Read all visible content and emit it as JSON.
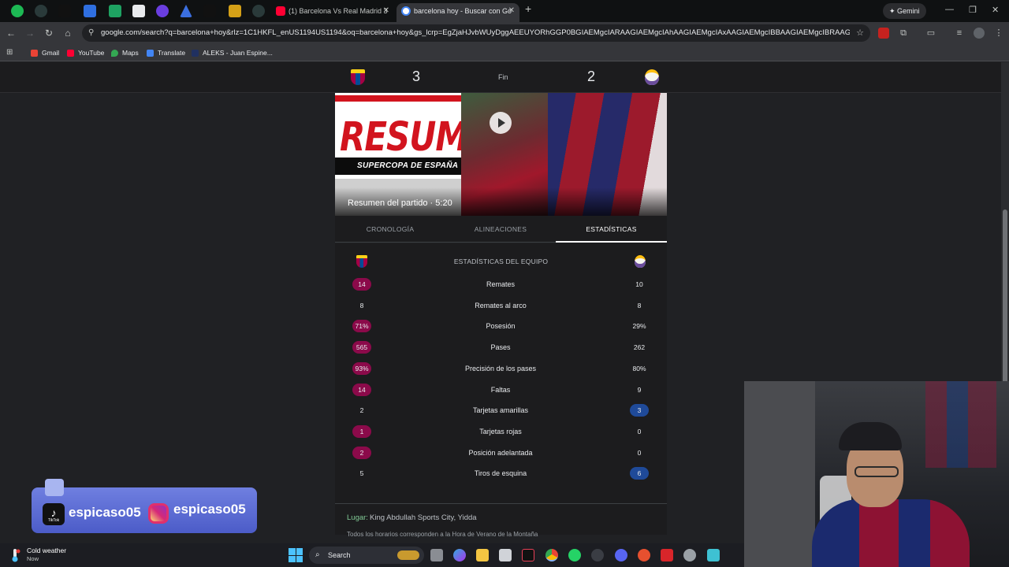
{
  "browser": {
    "tabs": [
      {
        "title": "(1) Barcelona Vs Real Madrid 3",
        "active": false
      },
      {
        "title": "barcelona hoy - Buscar con Go",
        "active": true
      }
    ],
    "gemini_label": "Gemini",
    "url": "google.com/search?q=barcelona+hoy&rlz=1C1HKFL_enUS1194US1194&oq=barcelona+hoy&gs_lcrp=EgZjaHJvbWUyDggAEEUYORhGGP0BGIAEMgcIARAAGIAEMgcIAhAAGIAEMgcIAxAAGIAEMgcIBBAAGIAEMgcIBRAAGIAEMgcIB...",
    "bookmarks": [
      "Gmail",
      "YouTube",
      "Maps",
      "Translate",
      "ALEKS - Juan Espine..."
    ]
  },
  "match": {
    "home_score": "3",
    "away_score": "2",
    "status": "Fin"
  },
  "video": {
    "overlay_title": "RESUMEN",
    "overlay_subtitle": "SUPERCOPA DE ESPAÑA",
    "caption": "Resumen del partido · 5:20"
  },
  "stats_tabs": [
    "CRONOLOGÍA",
    "ALINEACIONES",
    "ESTADÍSTICAS"
  ],
  "stats": {
    "title": "ESTADÍSTICAS DEL EQUIPO",
    "rows": [
      {
        "name": "Remates",
        "home": "14",
        "away": "10"
      },
      {
        "name": "Remates al arco",
        "home": "8",
        "away": "8"
      },
      {
        "name": "Posesión",
        "home": "71%",
        "away": "29%"
      },
      {
        "name": "Pases",
        "home": "565",
        "away": "262"
      },
      {
        "name": "Precisión de los pases",
        "home": "93%",
        "away": "80%"
      },
      {
        "name": "Faltas",
        "home": "14",
        "away": "9"
      },
      {
        "name": "Tarjetas amarillas",
        "home": "2",
        "away": "3"
      },
      {
        "name": "Tarjetas rojas",
        "home": "1",
        "away": "0"
      },
      {
        "name": "Posición adelantada",
        "home": "2",
        "away": "0"
      },
      {
        "name": "Tiros de esquina",
        "home": "5",
        "away": "6"
      }
    ]
  },
  "venue": {
    "label": "Lugar:",
    "value": "King Abdullah Sports City, Yidda"
  },
  "footnote": "Todos los horarios corresponden a la Hora de Verano de la Montaña",
  "social": {
    "tiktok_handle": "espicaso05",
    "tiktok_sub": "TikTok",
    "instagram_handle": "espicaso05"
  },
  "taskbar": {
    "weather_title": "Cold weather",
    "weather_sub": "Now",
    "search_label": "Search"
  },
  "colors": {
    "home_lead": "#8b0a4a",
    "away_lead": "#1f4a99"
  }
}
